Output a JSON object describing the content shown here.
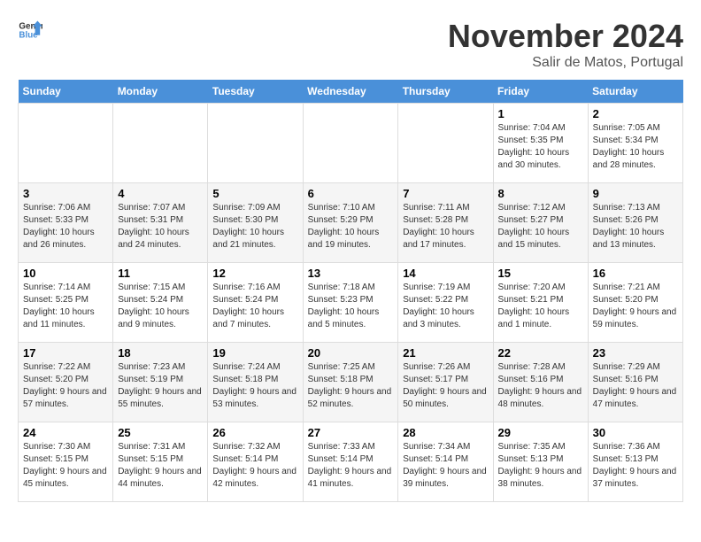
{
  "logo": {
    "text_general": "General",
    "text_blue": "Blue"
  },
  "header": {
    "month": "November 2024",
    "location": "Salir de Matos, Portugal"
  },
  "weekdays": [
    "Sunday",
    "Monday",
    "Tuesday",
    "Wednesday",
    "Thursday",
    "Friday",
    "Saturday"
  ],
  "weeks": [
    [
      {
        "day": "",
        "info": ""
      },
      {
        "day": "",
        "info": ""
      },
      {
        "day": "",
        "info": ""
      },
      {
        "day": "",
        "info": ""
      },
      {
        "day": "",
        "info": ""
      },
      {
        "day": "1",
        "info": "Sunrise: 7:04 AM\nSunset: 5:35 PM\nDaylight: 10 hours and 30 minutes."
      },
      {
        "day": "2",
        "info": "Sunrise: 7:05 AM\nSunset: 5:34 PM\nDaylight: 10 hours and 28 minutes."
      }
    ],
    [
      {
        "day": "3",
        "info": "Sunrise: 7:06 AM\nSunset: 5:33 PM\nDaylight: 10 hours and 26 minutes."
      },
      {
        "day": "4",
        "info": "Sunrise: 7:07 AM\nSunset: 5:31 PM\nDaylight: 10 hours and 24 minutes."
      },
      {
        "day": "5",
        "info": "Sunrise: 7:09 AM\nSunset: 5:30 PM\nDaylight: 10 hours and 21 minutes."
      },
      {
        "day": "6",
        "info": "Sunrise: 7:10 AM\nSunset: 5:29 PM\nDaylight: 10 hours and 19 minutes."
      },
      {
        "day": "7",
        "info": "Sunrise: 7:11 AM\nSunset: 5:28 PM\nDaylight: 10 hours and 17 minutes."
      },
      {
        "day": "8",
        "info": "Sunrise: 7:12 AM\nSunset: 5:27 PM\nDaylight: 10 hours and 15 minutes."
      },
      {
        "day": "9",
        "info": "Sunrise: 7:13 AM\nSunset: 5:26 PM\nDaylight: 10 hours and 13 minutes."
      }
    ],
    [
      {
        "day": "10",
        "info": "Sunrise: 7:14 AM\nSunset: 5:25 PM\nDaylight: 10 hours and 11 minutes."
      },
      {
        "day": "11",
        "info": "Sunrise: 7:15 AM\nSunset: 5:24 PM\nDaylight: 10 hours and 9 minutes."
      },
      {
        "day": "12",
        "info": "Sunrise: 7:16 AM\nSunset: 5:24 PM\nDaylight: 10 hours and 7 minutes."
      },
      {
        "day": "13",
        "info": "Sunrise: 7:18 AM\nSunset: 5:23 PM\nDaylight: 10 hours and 5 minutes."
      },
      {
        "day": "14",
        "info": "Sunrise: 7:19 AM\nSunset: 5:22 PM\nDaylight: 10 hours and 3 minutes."
      },
      {
        "day": "15",
        "info": "Sunrise: 7:20 AM\nSunset: 5:21 PM\nDaylight: 10 hours and 1 minute."
      },
      {
        "day": "16",
        "info": "Sunrise: 7:21 AM\nSunset: 5:20 PM\nDaylight: 9 hours and 59 minutes."
      }
    ],
    [
      {
        "day": "17",
        "info": "Sunrise: 7:22 AM\nSunset: 5:20 PM\nDaylight: 9 hours and 57 minutes."
      },
      {
        "day": "18",
        "info": "Sunrise: 7:23 AM\nSunset: 5:19 PM\nDaylight: 9 hours and 55 minutes."
      },
      {
        "day": "19",
        "info": "Sunrise: 7:24 AM\nSunset: 5:18 PM\nDaylight: 9 hours and 53 minutes."
      },
      {
        "day": "20",
        "info": "Sunrise: 7:25 AM\nSunset: 5:18 PM\nDaylight: 9 hours and 52 minutes."
      },
      {
        "day": "21",
        "info": "Sunrise: 7:26 AM\nSunset: 5:17 PM\nDaylight: 9 hours and 50 minutes."
      },
      {
        "day": "22",
        "info": "Sunrise: 7:28 AM\nSunset: 5:16 PM\nDaylight: 9 hours and 48 minutes."
      },
      {
        "day": "23",
        "info": "Sunrise: 7:29 AM\nSunset: 5:16 PM\nDaylight: 9 hours and 47 minutes."
      }
    ],
    [
      {
        "day": "24",
        "info": "Sunrise: 7:30 AM\nSunset: 5:15 PM\nDaylight: 9 hours and 45 minutes."
      },
      {
        "day": "25",
        "info": "Sunrise: 7:31 AM\nSunset: 5:15 PM\nDaylight: 9 hours and 44 minutes."
      },
      {
        "day": "26",
        "info": "Sunrise: 7:32 AM\nSunset: 5:14 PM\nDaylight: 9 hours and 42 minutes."
      },
      {
        "day": "27",
        "info": "Sunrise: 7:33 AM\nSunset: 5:14 PM\nDaylight: 9 hours and 41 minutes."
      },
      {
        "day": "28",
        "info": "Sunrise: 7:34 AM\nSunset: 5:14 PM\nDaylight: 9 hours and 39 minutes."
      },
      {
        "day": "29",
        "info": "Sunrise: 7:35 AM\nSunset: 5:13 PM\nDaylight: 9 hours and 38 minutes."
      },
      {
        "day": "30",
        "info": "Sunrise: 7:36 AM\nSunset: 5:13 PM\nDaylight: 9 hours and 37 minutes."
      }
    ]
  ]
}
